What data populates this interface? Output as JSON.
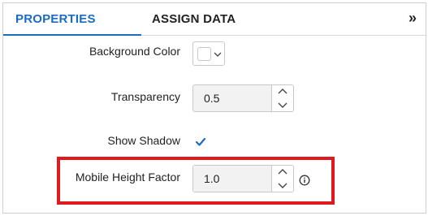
{
  "tabs": {
    "properties_label": "PROPERTIES",
    "assign_data_label": "ASSIGN DATA",
    "collapse_symbol": "»"
  },
  "fields": {
    "background_color": {
      "label": "Background Color",
      "value": "#ffffff"
    },
    "transparency": {
      "label": "Transparency",
      "value": "0.5"
    },
    "show_shadow": {
      "label": "Show Shadow",
      "checked": true
    },
    "mobile_height_factor": {
      "label": "Mobile Height Factor",
      "value": "1.0"
    }
  },
  "colors": {
    "accent": "#1b6bc1",
    "highlight": "#e0191f"
  },
  "icons": {
    "collapse": "double-chevron-right-icon",
    "dropdown": "chevron-down-icon",
    "spin_up": "chevron-up-icon",
    "spin_down": "chevron-down-icon",
    "checkbox": "checkmark-icon",
    "info": "info-icon"
  }
}
